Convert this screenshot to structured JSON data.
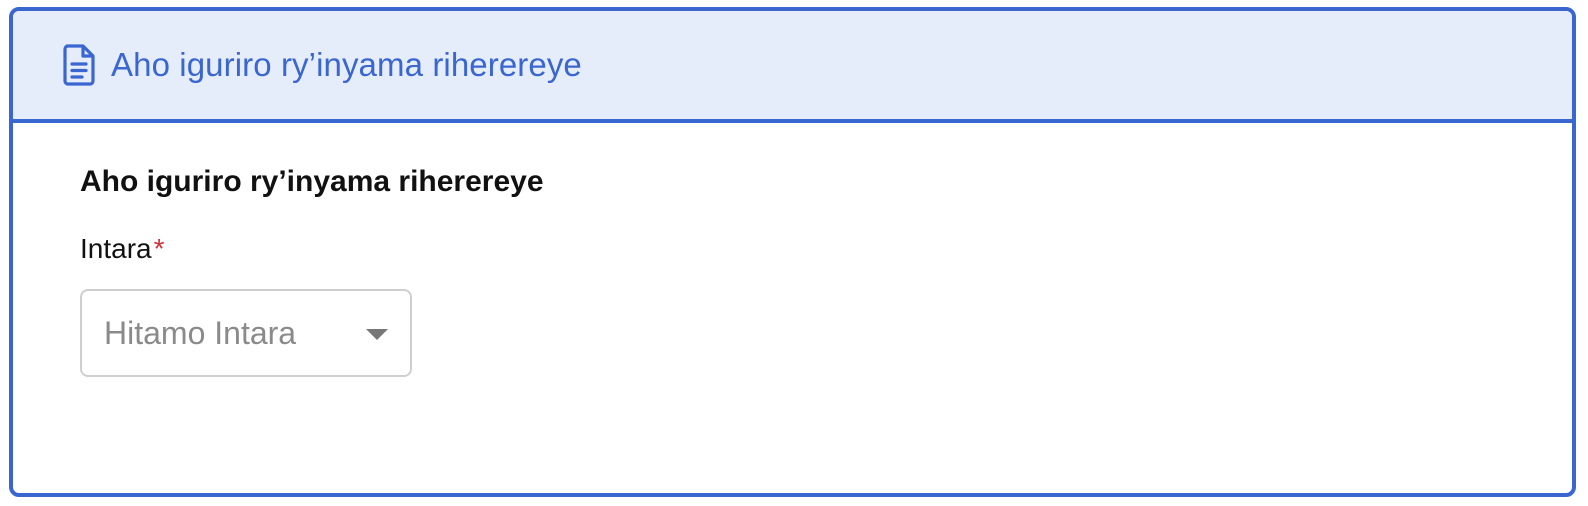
{
  "header": {
    "icon": "document-icon",
    "title": "Aho iguriro ry’inyama riherereye"
  },
  "form": {
    "section_title": "Aho iguriro ry’inyama riherereye",
    "province": {
      "label": "Intara",
      "required_mark": "*",
      "placeholder": "Hitamo Intara"
    }
  },
  "colors": {
    "accent": "#3a66d1",
    "header_bg": "#e5ecfa",
    "required": "#d32f3a"
  }
}
